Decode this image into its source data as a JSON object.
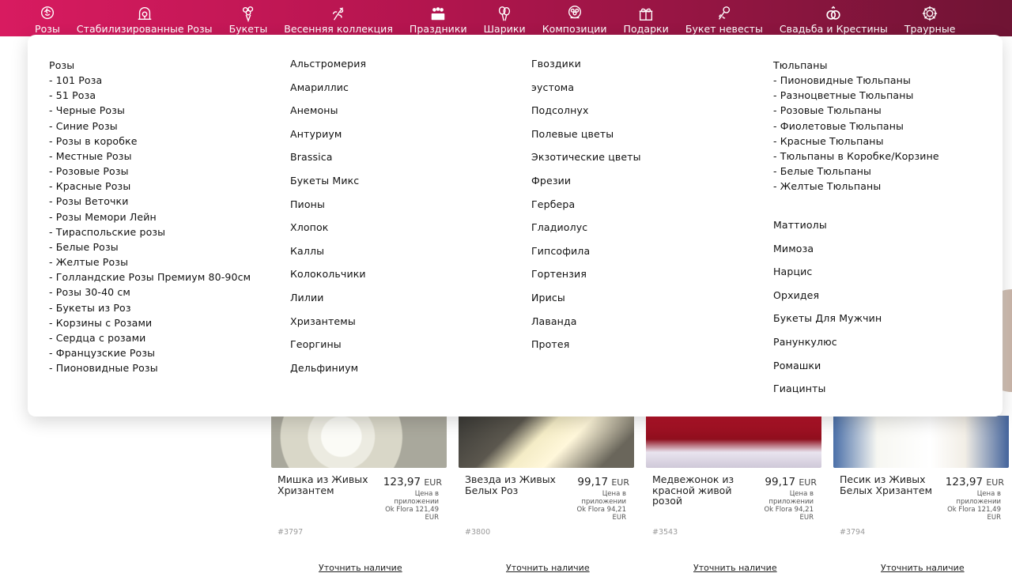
{
  "nav": {
    "items": [
      {
        "label": "Розы",
        "icon": "rose-icon"
      },
      {
        "label": "Стабилизированные Розы",
        "icon": "rose-dome-icon"
      },
      {
        "label": "Букеты",
        "icon": "bouquet-icon"
      },
      {
        "label": "Весенняя коллекция",
        "icon": "tulip-branch-icon"
      },
      {
        "label": "Праздники",
        "icon": "celebration-icon"
      },
      {
        "label": "Шарики",
        "icon": "balloons-icon"
      },
      {
        "label": "Композиции",
        "icon": "flower-basket-icon"
      },
      {
        "label": "Подарки",
        "icon": "gift-icon"
      },
      {
        "label": "Букет невесты",
        "icon": "bridal-bouquet-icon"
      },
      {
        "label": "Свадьба и Крестины",
        "icon": "rings-icon"
      },
      {
        "label": "Траурные",
        "icon": "wreath-icon"
      }
    ]
  },
  "menu": {
    "col1": [
      "Розы",
      "- 101 Роза",
      "- 51 Роза",
      "- Черные Розы",
      "- Синие Розы",
      "- Розы в коробке",
      "- Местные Розы",
      "- Розовые Розы",
      "- Красные Розы",
      "- Розы Веточки",
      "- Розы Мемори Лейн",
      "- Тираспольские розы",
      "- Белые Розы",
      "- Желтые Розы",
      "- Голландские Розы Премиум 80-90см",
      "- Розы 30-40 см",
      "- Букеты из Роз",
      "- Корзины с Розами",
      "- Сердца с розами",
      "- Французские Розы",
      "- Пионовидные Розы"
    ],
    "col2": [
      "Альстромерия",
      "Амариллис",
      "Анемоны",
      "Антуриум",
      "Brassica",
      "Букеты Микс",
      "Пионы",
      "Хлопок",
      "Каллы",
      "Колокольчики",
      "Лилии",
      "Хризантемы",
      "Георгины",
      "Дельфиниум"
    ],
    "col3": [
      "Гвоздики",
      "эустома",
      "Подсолнух",
      "Полевые цветы",
      "Экзотические цветы",
      "Фрезии",
      "Гербера",
      "Гладиолус",
      "Гипсофила",
      "Гортензия",
      "Ирисы",
      "Лаванда",
      "Протея"
    ],
    "col4a": [
      "Тюльпаны",
      "- Пионовидные Тюльпаны",
      "- Разноцветные Тюльпаны",
      "- Розовые Тюльпаны",
      "- Фиолетовые Тюльпаны",
      "- Красные Тюльпаны",
      "- Тюльпаны в Коробке/Корзине",
      "- Белые Тюльпаны",
      "- Желтые Тюльпаны"
    ],
    "col4b": [
      "Маттиолы",
      "Мимоза",
      "Нарцис",
      "Орхидея",
      "Букеты Для Мужчин",
      "Ранункулюс",
      "Ромашки",
      "Гиацинты"
    ]
  },
  "products": [
    {
      "name": "Мишка из Живых Хризантем",
      "price": "123,97",
      "currency": "EUR",
      "app_note": "Цена в приложении Ok Flora 121,49 EUR",
      "sku": "#3797",
      "avail": "Уточнить наличие"
    },
    {
      "name": "Звезда из Живых Белых Роз",
      "price": "99,17",
      "currency": "EUR",
      "app_note": "Цена в приложении Ok Flora 94,21 EUR",
      "sku": "#3800",
      "avail": "Уточнить наличие"
    },
    {
      "name": "Медвежонок из красной живой розой",
      "price": "99,17",
      "currency": "EUR",
      "app_note": "Цена в приложении Ok Flora 94,21 EUR",
      "sku": "#3543",
      "avail": "Уточнить наличие"
    },
    {
      "name": "Песик из Живых Белых Хризантем",
      "price": "123,97",
      "currency": "EUR",
      "app_note": "Цена в приложении Ok Flora 121,49 EUR",
      "sku": "#3794",
      "avail": "Уточнить наличие"
    }
  ],
  "colors": {
    "nav_start": "#d81b60",
    "nav_end": "#6f1434",
    "menu_bg": "#ffffff",
    "text": "#111111"
  }
}
